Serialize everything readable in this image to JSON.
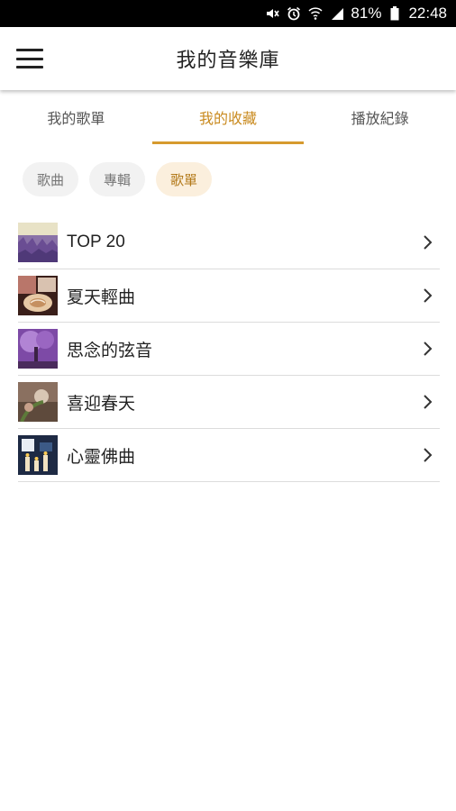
{
  "status_bar": {
    "battery": "81%",
    "time": "22:48",
    "icons": [
      "mute-icon",
      "alarm-icon",
      "wifi-icon",
      "signal-icon",
      "battery-icon"
    ]
  },
  "header": {
    "title": "我的音樂庫",
    "menu_icon": "hamburger-menu-icon"
  },
  "tabs": [
    {
      "label": "我的歌單",
      "active": false
    },
    {
      "label": "我的收藏",
      "active": true
    },
    {
      "label": "播放紀錄",
      "active": false
    }
  ],
  "filters": [
    {
      "label": "歌曲",
      "active": false
    },
    {
      "label": "專輯",
      "active": false
    },
    {
      "label": "歌單",
      "active": true
    }
  ],
  "playlists": [
    {
      "title": "TOP 20",
      "thumbnail": "lavender-field-thumbnail"
    },
    {
      "title": "夏天輕曲",
      "thumbnail": "coffee-cup-thumbnail"
    },
    {
      "title": "思念的弦音",
      "thumbnail": "purple-tree-thumbnail"
    },
    {
      "title": "喜迎春天",
      "thumbnail": "flower-thumbnail"
    },
    {
      "title": "心靈佛曲",
      "thumbnail": "candles-thumbnail"
    }
  ],
  "colors": {
    "accent": "#d69a2e",
    "accent_text": "#c98a1e",
    "chip_active_bg": "#fbefdd",
    "chip_bg": "#f2f2f2",
    "divider": "#dcdcdc"
  }
}
